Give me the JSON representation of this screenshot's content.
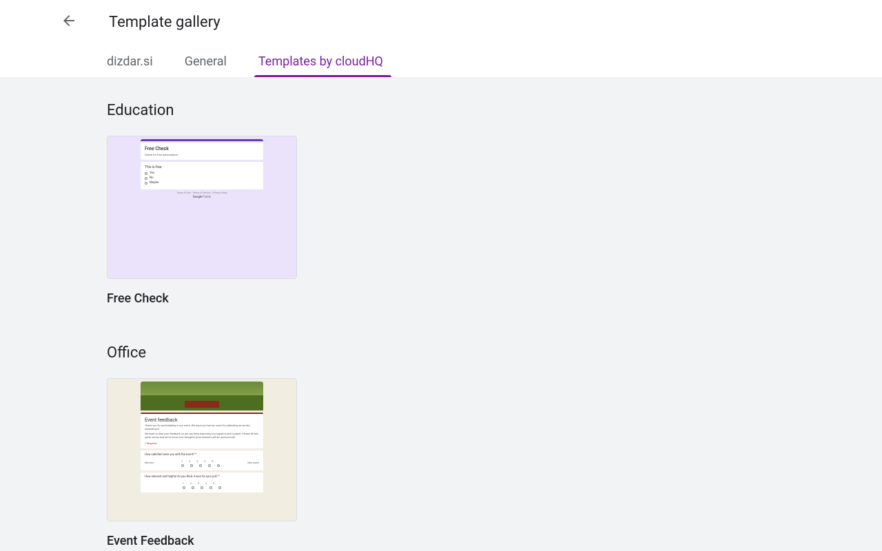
{
  "header": {
    "title": "Template gallery"
  },
  "tabs": [
    {
      "label": "dizdar.si",
      "active": false
    },
    {
      "label": "General",
      "active": false
    },
    {
      "label": "Templates by cloudHQ",
      "active": true
    }
  ],
  "sections": [
    {
      "title": "Education",
      "templates": [
        {
          "name": "Free Check",
          "thumb": {
            "title": "Free Check",
            "subtitle": "Check for free subscription",
            "question": "This is free",
            "options": [
              "Yes",
              "No",
              "Maybe"
            ],
            "footer_links": "Terms of Use · Terms of Service · Privacy Policy",
            "google_brand": "Google",
            "google_product": "Forms"
          }
        }
      ]
    },
    {
      "title": "Office",
      "templates": [
        {
          "name": "Event Feedback",
          "thumb": {
            "title": "Event feedback",
            "desc1": "Thank you for participating in our event. We hope you had as much fun attending as we did organizing it.",
            "desc2": "We want to hear your feedback so we can keep improving our logistics and content. Please fill this quick survey and let us know your thoughts (your answers will be anonymous).",
            "required": "* Required",
            "q1": "How satisfied were you with the event? *",
            "scale_low": "Not very",
            "scale_high": "Very much",
            "nums": [
              "1",
              "2",
              "3",
              "4",
              "5"
            ],
            "q2": "How relevant and helpful do you think it was for your job? *"
          }
        }
      ]
    }
  ]
}
